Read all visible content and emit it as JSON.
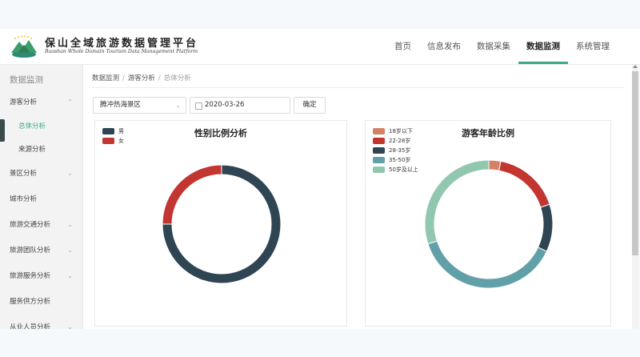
{
  "brand": {
    "title_cn": "保山全域旅游数据管理平台",
    "title_en": "Baoshan Whole Domain Tourism Data Management Platform"
  },
  "nav": {
    "items": [
      "首页",
      "信息发布",
      "数据采集",
      "数据监测",
      "系统管理"
    ],
    "active": "数据监测"
  },
  "sidebar": {
    "title": "数据监测",
    "items": [
      {
        "label": "游客分析",
        "expanded": true
      },
      {
        "label": "总体分析",
        "sub": true,
        "active": true
      },
      {
        "label": "来源分析",
        "sub": true
      },
      {
        "label": "景区分析"
      },
      {
        "label": "城市分析"
      },
      {
        "label": "旅游交通分析"
      },
      {
        "label": "旅游团队分析"
      },
      {
        "label": "旅游服务分析"
      },
      {
        "label": "服务供方分析"
      },
      {
        "label": "从业人员分析"
      }
    ]
  },
  "breadcrumb": [
    "数据监测",
    "游客分析",
    "总体分析"
  ],
  "filters": {
    "scenic_area": "腾冲热海景区",
    "date": "2020-03-26",
    "confirm_label": "确定"
  },
  "colors": {
    "accent": "#3daa86",
    "dark": "#2f4554",
    "red": "#c23531",
    "teal": "#61a0a8",
    "orange": "#d48265",
    "mint": "#91c7ae"
  },
  "chart_data": [
    {
      "type": "pie",
      "title": "性别比例分析",
      "legend_placement": "top-left",
      "series": [
        {
          "name": "男",
          "value": 75,
          "color": "#2f4554"
        },
        {
          "name": "女",
          "value": 25,
          "color": "#c23531"
        }
      ]
    },
    {
      "type": "pie",
      "title": "游客年龄比例",
      "legend_placement": "top-left",
      "series": [
        {
          "name": "18岁以下",
          "value": 3,
          "color": "#d48265"
        },
        {
          "name": "22-28岁",
          "value": 17,
          "color": "#c23531"
        },
        {
          "name": "28-35岁",
          "value": 12,
          "color": "#2f4554"
        },
        {
          "name": "35-50岁",
          "value": 38,
          "color": "#61a0a8"
        },
        {
          "name": "50岁及以上",
          "value": 30,
          "color": "#91c7ae"
        }
      ]
    }
  ]
}
